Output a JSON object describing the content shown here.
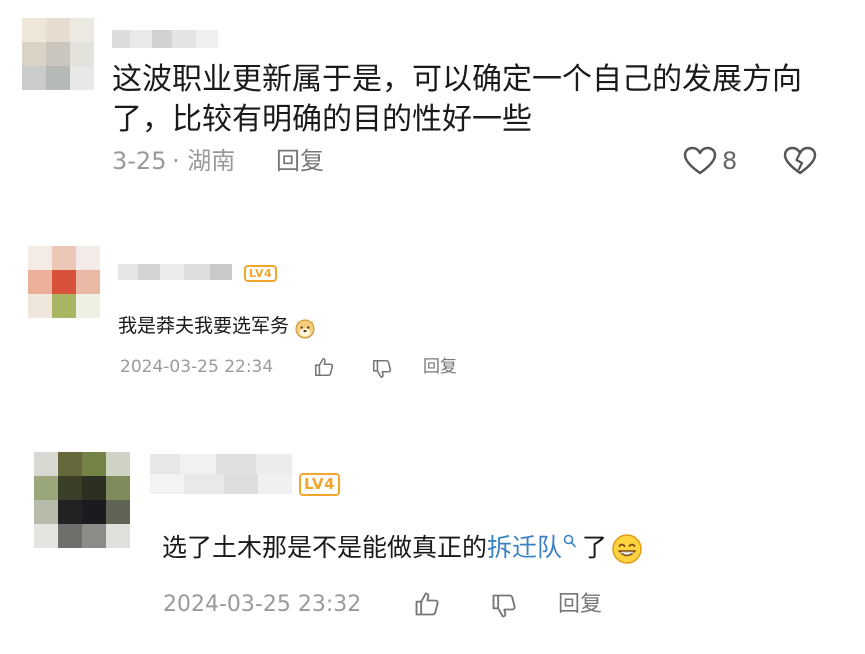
{
  "comments": [
    {
      "text_line1": "这波职业更新属于是，可以确定一个自己的发展方向",
      "text_line2": "了，比较有明确的目的性好一些",
      "date": "3-25",
      "location": "· 湖南",
      "reply_label": "回复",
      "like_count": "8",
      "icons": [
        "heart-icon",
        "broken-heart-icon"
      ]
    },
    {
      "badge": "LV4",
      "text": "我是莽夫我要选军务",
      "emoji": "doge-emoji",
      "timestamp": "2024-03-25 22:34",
      "reply_label": "回复",
      "icons": [
        "thumbs-up-icon",
        "thumbs-down-icon"
      ]
    },
    {
      "badge": "LV4",
      "text_before": "选了土木那是不是能做真正的",
      "link_text": "拆迁队",
      "text_after": "了",
      "emoji": "grin-emoji",
      "timestamp": "2024-03-25 23:32",
      "reply_label": "回复",
      "icons": [
        "search-icon",
        "thumbs-up-icon",
        "thumbs-down-icon"
      ]
    }
  ],
  "colors": {
    "badge": "#f2a62e",
    "link": "#3b82c4",
    "meta": "#9a9a9a"
  }
}
